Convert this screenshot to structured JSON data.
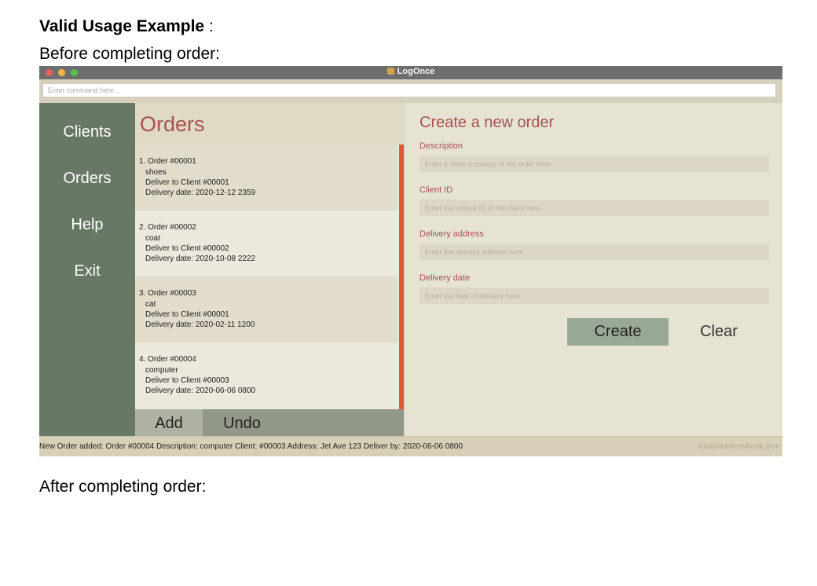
{
  "doc": {
    "heading_bold": "Valid Usage Example",
    "heading_suffix": " :",
    "before_label": "Before completing order:",
    "after_label": "After completing order:"
  },
  "window": {
    "title": "LogOnce"
  },
  "command": {
    "placeholder": "Enter command here..."
  },
  "sidebar": {
    "items": [
      {
        "label": "Clients"
      },
      {
        "label": "Orders"
      },
      {
        "label": "Help"
      },
      {
        "label": "Exit"
      }
    ]
  },
  "orders": {
    "title": "Orders",
    "items": [
      {
        "line1": "1.  Order #00001",
        "line2": "shoes",
        "line3": "Deliver to Client #00001",
        "line4": "Delivery date: 2020-12-12 2359"
      },
      {
        "line1": "2.  Order #00002",
        "line2": "coat",
        "line3": "Deliver to Client #00002",
        "line4": "Delivery date: 2020-10-08 2222"
      },
      {
        "line1": "3.  Order #00003",
        "line2": "cat",
        "line3": "Deliver to Client #00001",
        "line4": "Delivery date: 2020-02-11 1200"
      },
      {
        "line1": "4.  Order #00004",
        "line2": "computer",
        "line3": "Deliver to Client #00003",
        "line4": "Delivery date: 2020-06-06 0800"
      }
    ],
    "add_label": "Add",
    "undo_label": "Undo"
  },
  "form": {
    "title": "Create a new order",
    "fields": [
      {
        "label": "Description",
        "placeholder": "Enter a short summary of the order here"
      },
      {
        "label": "Client ID",
        "placeholder": "Enter the unique ID of the client here"
      },
      {
        "label": "Delivery address",
        "placeholder": "Enter the delivery address here"
      },
      {
        "label": "Delivery date",
        "placeholder": "Enter the date of delivery here"
      }
    ],
    "create_label": "Create",
    "clear_label": "Clear"
  },
  "status": {
    "message": "New Order added: Order #00004  Description: computer Client: #00003 Address: Jet Ave 123 Deliver by: 2020-06-06 0800",
    "path": "./data/addressbook.json"
  },
  "colors": {
    "sidebar": "#677864",
    "accent_title": "#a65350",
    "scroll_thumb": "#e5553a",
    "create_button": "#9aa896"
  }
}
